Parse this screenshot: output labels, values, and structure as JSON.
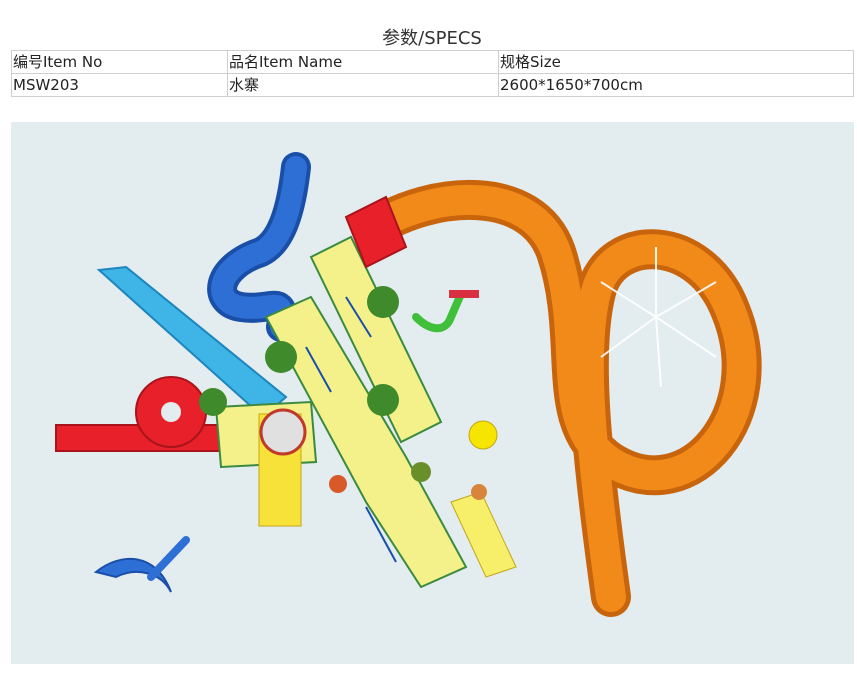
{
  "page": {
    "title": "参数/SPECS"
  },
  "specs": {
    "headers": [
      "编号Item No",
      "品名Item Name",
      "规格Size"
    ],
    "row": [
      "MSW203",
      "水寨",
      "2600*1650*700cm"
    ]
  },
  "render": {
    "description_icon": "water-playground-render",
    "colors": {
      "water": "#e3ecef",
      "deck": "#f5f18a",
      "orange_slide": "#f28a1a",
      "blue_slide": "#2e6fd6",
      "cyan_slide": "#3fb4e6",
      "red_slide": "#e8202a",
      "palm": "#3f8a2a"
    }
  }
}
